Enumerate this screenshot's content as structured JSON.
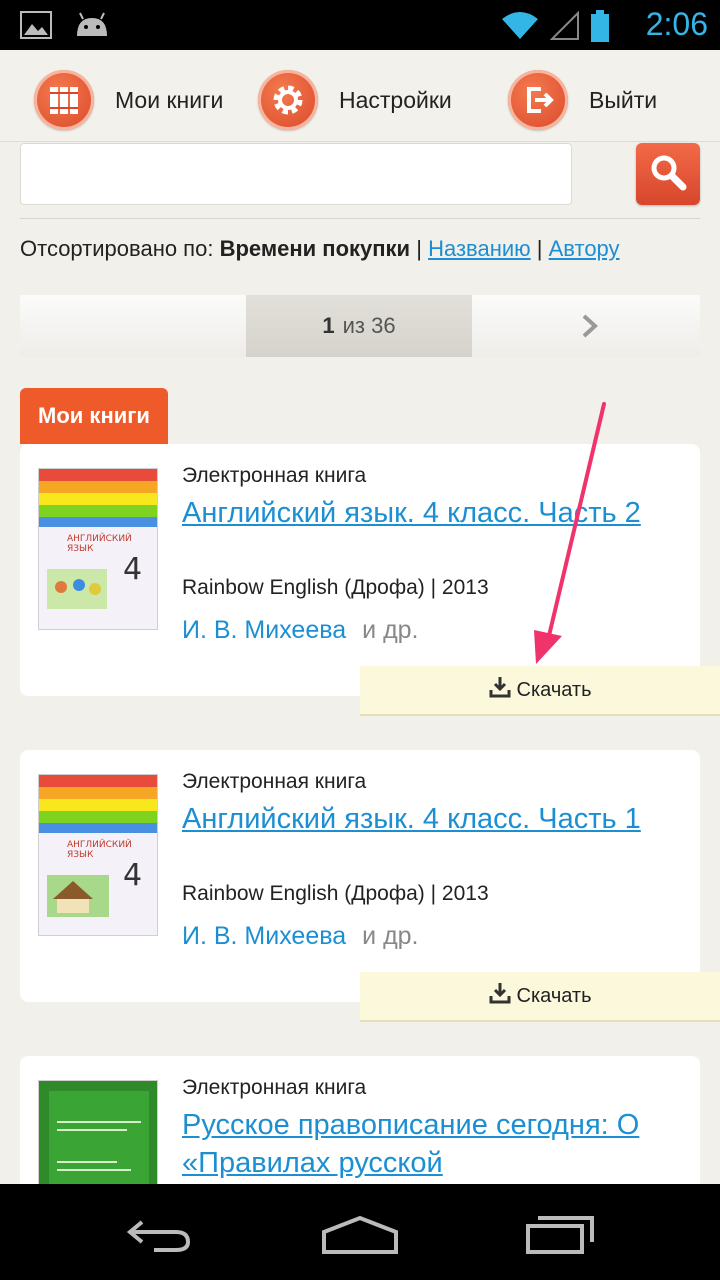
{
  "status_bar": {
    "time": "2:06"
  },
  "nav": {
    "my_books": "Мои книги",
    "settings": "Настройки",
    "logout": "Выйти"
  },
  "search": {
    "value": "",
    "placeholder": ""
  },
  "sort": {
    "prefix": "Отсортировано по:",
    "current": "Времени покупки",
    "sep": "|",
    "by_title": "Названию",
    "by_author": "Автору"
  },
  "pager": {
    "current": "1",
    "of_label": "из 36"
  },
  "section_tab": "Мои книги",
  "books": [
    {
      "kind": "Электронная книга",
      "title": "Английский язык. 4 класс. Часть 2",
      "meta": "Rainbow English (Дрофа) | 2013",
      "author": "И. В. Михеева",
      "more": "и др.",
      "download": "Скачать"
    },
    {
      "kind": "Электронная книга",
      "title": "Английский язык. 4 класс. Часть 1",
      "meta": "Rainbow English (Дрофа) | 2013",
      "author": "И. В. Михеева",
      "more": "и др.",
      "download": "Скачать"
    },
    {
      "kind": "Электронная книга",
      "title": "Русское правописание сегодня: О «Правилах русской",
      "meta": "",
      "author": "",
      "more": "",
      "download": ""
    }
  ],
  "colors": {
    "accent": "#ef5a2b",
    "link": "#1c8fd3",
    "status_time": "#33b5e5",
    "annotation_arrow": "#f0336b"
  }
}
